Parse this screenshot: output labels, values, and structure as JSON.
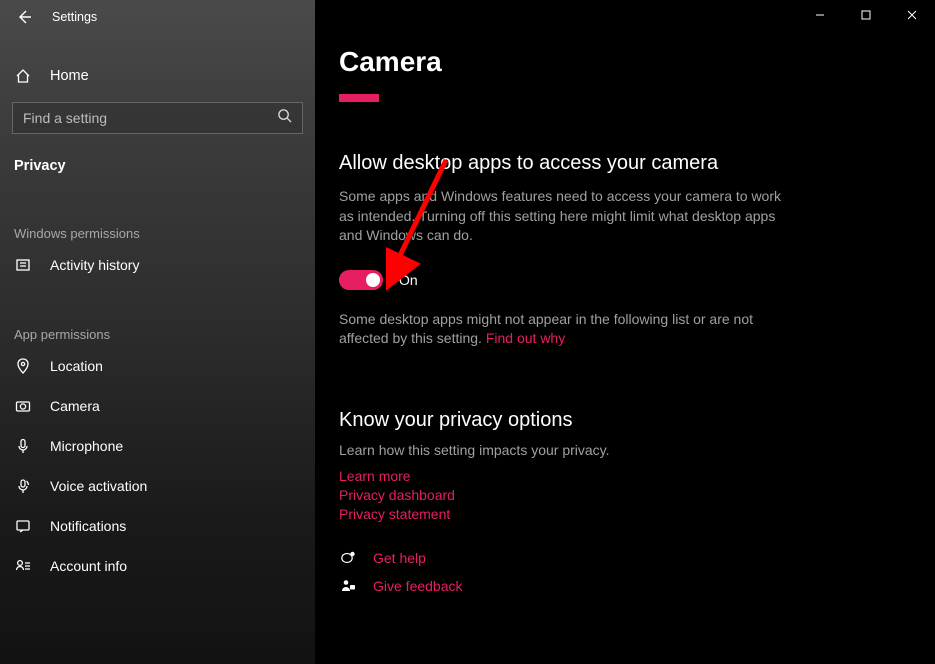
{
  "window": {
    "title": "Settings"
  },
  "sidebar": {
    "home": "Home",
    "search_placeholder": "Find a setting",
    "category": "Privacy",
    "groups": [
      {
        "header": "Windows permissions",
        "items": [
          {
            "label": "Activity history"
          }
        ]
      },
      {
        "header": "App permissions",
        "items": [
          {
            "label": "Location"
          },
          {
            "label": "Camera"
          },
          {
            "label": "Microphone"
          },
          {
            "label": "Voice activation"
          },
          {
            "label": "Notifications"
          },
          {
            "label": "Account info"
          }
        ]
      }
    ]
  },
  "main": {
    "title": "Camera",
    "section1": {
      "heading": "Allow desktop apps to access your camera",
      "desc": "Some apps and Windows features need to access your camera to work as intended. Turning off this setting here might limit what desktop apps and Windows can do.",
      "toggle_state": "On",
      "note": "Some desktop apps might not appear in the following list or are not affected by this setting. ",
      "note_link": "Find out why"
    },
    "section2": {
      "heading": "Know your privacy options",
      "sub": "Learn how this setting impacts your privacy.",
      "links": [
        "Learn more",
        "Privacy dashboard",
        "Privacy statement"
      ]
    },
    "help": {
      "get_help": "Get help",
      "feedback": "Give feedback"
    }
  }
}
